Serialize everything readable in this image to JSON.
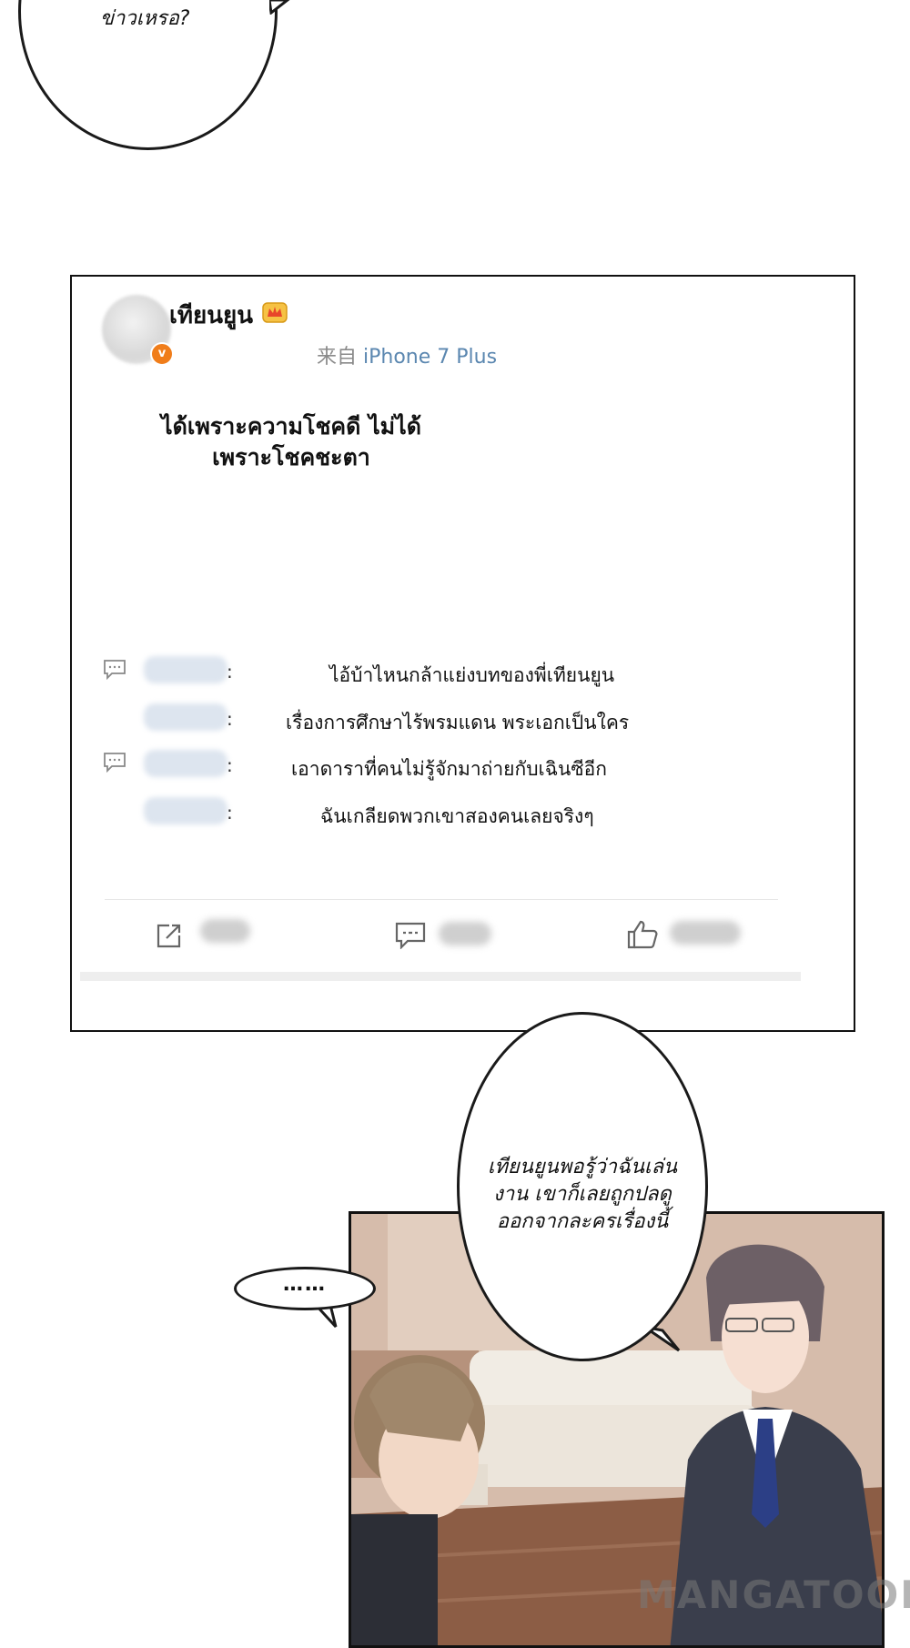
{
  "top_bubble": {
    "text": "ข่าวเหรอ?"
  },
  "post": {
    "username": "เทียนยูน",
    "source_prefix": "来自",
    "source_device": "iPhone 7 Plus",
    "text_line1": "ได้เพราะความโชคดี ไม่ได้",
    "text_line2": "เพราะโชคชะตา",
    "comments": [
      {
        "text": "ไอ้บ้าไหนกล้าแย่งบทของพี่เทียนยูน"
      },
      {
        "text": "เรื่องการศึกษาไร้พรมแดน พระเอกเป็นใคร"
      },
      {
        "text": "เอาดาราที่คนไม่รู้จักมาถ่ายกับเฉินซีอีก"
      },
      {
        "text": "ฉันเกลียดพวกเขาสองคนเลยจริงๆ"
      }
    ],
    "comment_colon": ":",
    "actions": [
      "share-icon",
      "comment-icon",
      "like-icon"
    ]
  },
  "big_bubble": {
    "line1": "เทียนยูนพอรู้ว่าฉันเล่น",
    "line2": "งาน เขาก็เลยถูกปลดู",
    "line3": "ออกจากละครเรื่องนี้"
  },
  "small_bubble": {
    "text": "……"
  },
  "watermark": {
    "text": "MANGATOON"
  },
  "colors": {
    "verified_badge": "#f07d1a",
    "source_device": "#5b87b0",
    "source_prefix": "#8a8a8a"
  }
}
